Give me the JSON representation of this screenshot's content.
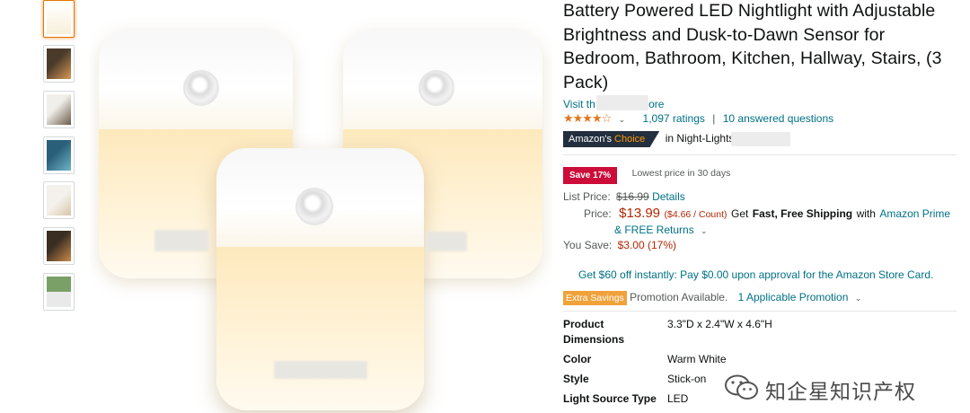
{
  "thumbnails": [
    {
      "name": "thumb-1",
      "colors": [
        "#f7efd9",
        "#ffffff"
      ],
      "active": true
    },
    {
      "name": "thumb-2",
      "colors": [
        "#4a3a2a",
        "#d99a55"
      ]
    },
    {
      "name": "thumb-3",
      "colors": [
        "#6b5b4a",
        "#e8c690"
      ]
    },
    {
      "name": "thumb-4",
      "colors": [
        "#2a5f7a",
        "#6fb5c8"
      ]
    },
    {
      "name": "thumb-5",
      "colors": [
        "#f4f1ec",
        "#d8c6a8"
      ]
    },
    {
      "name": "thumb-6",
      "colors": [
        "#3a2d22",
        "#c98a4a"
      ]
    },
    {
      "name": "thumb-7",
      "colors": [
        "#7aa067",
        "#e9e9e9"
      ]
    }
  ],
  "product": {
    "title": "Battery Powered LED Nightlight with Adjustable Brightness and Dusk-to-Dawn Sensor for Bedroom, Bathroom, Kitchen, Hallway, Stairs, (3 Pack)",
    "visit_store_prefix": "Visit th",
    "visit_store_suffix": "tore",
    "rating_stars": "★★★★☆",
    "rating_value": 4.5,
    "ratings_count": "1,097 ratings",
    "separator": "|",
    "answered_questions": "10 answered questions",
    "choice_badge_main": "Amazon's ",
    "choice_badge_accent": "Choice",
    "choice_category": "in Night-Lights"
  },
  "pricing": {
    "save_badge": "Save 17%",
    "lowest_price_note": "Lowest price in 30 days",
    "list_price_label": "List Price:",
    "list_price": "$16.99",
    "details_link": "Details",
    "price_label": "Price:",
    "price": "$13.99",
    "per_count": "($4.66 / Count)",
    "shipping_prefix": "Get",
    "shipping_bold": "Fast, Free Shipping",
    "shipping_with": "with",
    "prime_link": "Amazon Prime",
    "free_returns": "& FREE Returns",
    "you_save_label": "You Save:",
    "you_save_value": "$3.00 (17%)",
    "store_card_offer": "Get $60 off instantly: Pay $0.00 upon approval for the Amazon Store Card.",
    "extra_savings_badge": "Extra Savings",
    "promotion_available": "Promotion Available.",
    "applicable_promotion": "1 Applicable Promotion"
  },
  "specs": [
    {
      "label": "Product",
      "label2": "Dimensions",
      "value": "3.3\"D x 2.4\"W x 4.6\"H"
    },
    {
      "label": "Color",
      "value": "Warm White"
    },
    {
      "label": "Style",
      "value": "Stick-on"
    },
    {
      "label": "Light Source Type",
      "value": "LED"
    }
  ],
  "watermark": {
    "text": "知企星知识产权",
    "icon": "wechat-logo-icon"
  },
  "colors": {
    "link": "#007185",
    "price_red": "#b12704",
    "save_badge": "#cc0c39",
    "star": "#de7921",
    "extra_savings": "#f0a23a",
    "choice_badge_bg": "#232f3e"
  }
}
